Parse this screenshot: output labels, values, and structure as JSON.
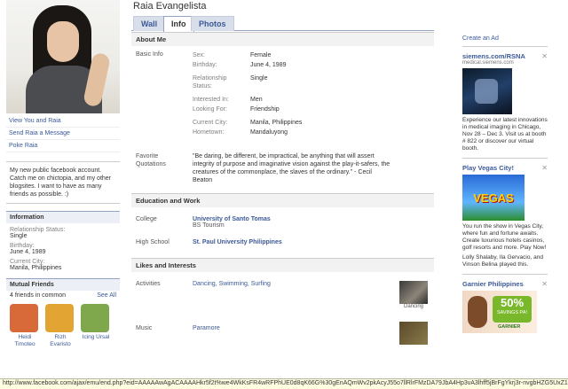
{
  "profile": {
    "name": "Raia Evangelista",
    "tabs": [
      "Wall",
      "Info",
      "Photos"
    ],
    "active_tab": "Info"
  },
  "left": {
    "links": [
      "View You and Raia",
      "Send Raia a Message",
      "Poke Raia"
    ],
    "bio": "My new public facebook account. Catch me on chictopia, and my other blogsites. I want to have as many friends as possible. :)",
    "information": {
      "header": "Information",
      "items": [
        {
          "label": "Relationship Status:",
          "value": "Single"
        },
        {
          "label": "Birthday:",
          "value": "June 4, 1989"
        },
        {
          "label": "Current City:",
          "value": "Manila, Philippines"
        }
      ]
    },
    "mutual": {
      "header": "Mutual Friends",
      "count": "4 friends in common",
      "see_all": "See All",
      "friends": [
        {
          "name": "Heidi Timoteo",
          "color": "#d86a3a"
        },
        {
          "name": "Rizh Evaristo",
          "color": "#e2a533"
        },
        {
          "name": "Icing Ursal",
          "color": "#7fa84d"
        }
      ]
    }
  },
  "main": {
    "about": {
      "header": "About Me",
      "basic_label": "Basic Info",
      "basic": [
        {
          "key": "Sex:",
          "value": "Female"
        },
        {
          "key": "Birthday:",
          "value": "June 4, 1989"
        },
        {
          "key": "Relationship Status:",
          "value": "Single"
        },
        {
          "key": "Interested In:",
          "value": "Men"
        },
        {
          "key": "Looking For:",
          "value": "Friendship"
        },
        {
          "key": "Current City:",
          "value": "Manila, Philippines"
        },
        {
          "key": "Hometown:",
          "value": "Mandaluyong"
        }
      ],
      "quotes_label": "Favorite Quotations",
      "quotes": "\"Be daring, be different, be impractical, be anything that will assert integrity of purpose and imaginative vision against the play-it-safers, the creatures of the commonplace, the slaves of the ordinary.\" - Cecil Beaton"
    },
    "education": {
      "header": "Education and Work",
      "college_label": "College",
      "college": "University of Santo Tomas",
      "college_sub": "BS Tourism",
      "hs_label": "High School",
      "hs": "St. Paul University Philippines"
    },
    "likes": {
      "header": "Likes and Interests",
      "activities_label": "Activities",
      "activities": "Dancing, Swimming, Surfing",
      "activity_thumb": "Dancing",
      "music_label": "Music",
      "music": "Paramore"
    }
  },
  "ads": {
    "create": "Create an Ad",
    "items": [
      {
        "title": "siemens.com/RSNA",
        "url": "medical.siemens.com",
        "text": "Experience our latest innovations in medical imaging in Chicago, Nov 28 – Dec 3. Visit us at booth # 822 or discover our virtual booth."
      },
      {
        "title": "Play Vegas City!",
        "image_text": "VEGAS",
        "text": "You run the show in Vegas City, where fun and fortune awaits. Create luxurious hotels casinos, golf resorts and more. Play Now!",
        "social_names": [
          "Lolly Shalaby",
          "Ila Gervacio",
          "Vinson Belina"
        ],
        "social_text": "Lolly Shalaby, Ila Gervacio, and Vinson Belina played this."
      },
      {
        "title": "Garnier Philippines",
        "badge": "50%",
        "badge_sub": "SAVINGS PA!",
        "brand": "GARNIER"
      }
    ]
  },
  "statusbar": "http://www.facebook.com/ajax/emu/end.php?eid=AAAAAwAgACAAAAHkr5f2t%we4WkKsFR4wRFPhUE0d8qK66G%30gEnAQmWv2pkAcyJ55o7llRlrFMzDA79JbA4Hp3vA3lhff5jBrFgYkrj3r-nvgbHZG5UxZ1Tlvo-com"
}
